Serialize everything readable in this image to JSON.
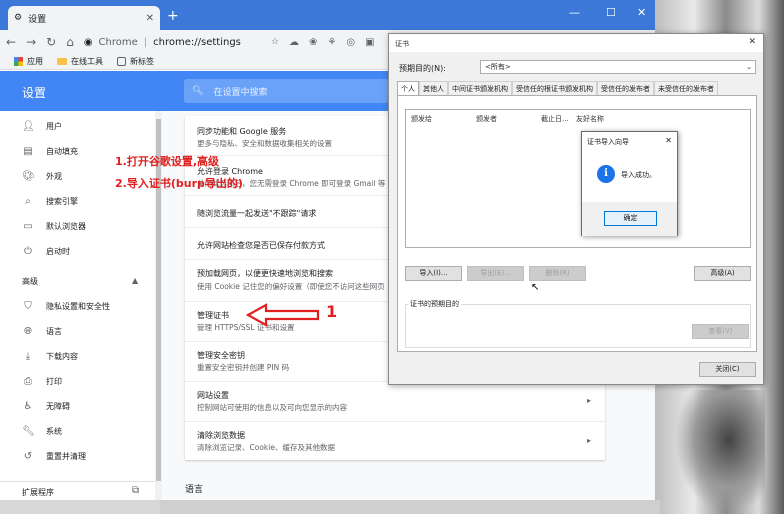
{
  "browser": {
    "tab_title": "设置",
    "url_prefix": "Chrome",
    "url": "chrome://settings",
    "bookmarks": [
      {
        "label": "应用"
      },
      {
        "label": "在线工具"
      },
      {
        "label": "新标签"
      }
    ]
  },
  "settings": {
    "title": "设置",
    "search_placeholder": "在设置中搜索",
    "sidebar": {
      "items": [
        {
          "label": "用户",
          "icon": "person-icon"
        },
        {
          "label": "自动填充",
          "icon": "clipboard-icon"
        },
        {
          "label": "外观",
          "icon": "palette-icon"
        },
        {
          "label": "搜索引擎",
          "icon": "search-icon"
        },
        {
          "label": "默认浏览器",
          "icon": "browser-icon"
        },
        {
          "label": "启动时",
          "icon": "power-icon"
        }
      ],
      "advanced_label": "高级",
      "advanced_items": [
        {
          "label": "隐私设置和安全性",
          "icon": "shield-icon"
        },
        {
          "label": "语言",
          "icon": "globe-icon"
        },
        {
          "label": "下载内容",
          "icon": "download-icon"
        },
        {
          "label": "打印",
          "icon": "printer-icon"
        },
        {
          "label": "无障碍",
          "icon": "accessibility-icon"
        },
        {
          "label": "系统",
          "icon": "wrench-icon"
        },
        {
          "label": "重置并清理",
          "icon": "reset-icon"
        }
      ],
      "extensions_label": "扩展程序"
    },
    "rows": [
      {
        "title": "同步功能和 Google 服务",
        "sub": "更多与隐私、安全和数据收集相关的设置"
      },
      {
        "title": "允许登录 Chrome",
        "sub": "关闭此选项后，您无需登录 Chrome 即可登录 Gmail 等"
      },
      {
        "title": "随浏览流量一起发送\"不跟踪\"请求",
        "sub": ""
      },
      {
        "title": "允许网站检查您是否已保存付款方式",
        "sub": ""
      },
      {
        "title": "预加载网页，以便更快速地浏览和搜索",
        "sub": "使用 Cookie 记住您的偏好设置（即使您不访问这些网页"
      },
      {
        "title": "管理证书",
        "sub": "管理 HTTPS/SSL 证书和设置"
      },
      {
        "title": "管理安全密钥",
        "sub": "重置安全密钥并创建 PIN 码"
      },
      {
        "title": "网站设置",
        "sub": "控制网站可使用的信息以及可向您显示的内容"
      },
      {
        "title": "清除浏览数据",
        "sub": "清除浏览记录、Cookie、缓存及其他数据"
      }
    ],
    "language_section": "语言"
  },
  "annotations": {
    "step_text_1": "1.打开谷歌设置,高级",
    "step_text_2": "2.导入证书(burp导出的)",
    "num_1": "1",
    "num_2": "2"
  },
  "cert_dialog": {
    "title": "证书",
    "purpose_label": "预期目的(N):",
    "purpose_value": "<所有>",
    "tabs": [
      "个人",
      "其他人",
      "中间证书颁发机构",
      "受信任的根证书颁发机构",
      "受信任的发布者",
      "未受信任的发布者"
    ],
    "columns": [
      "颁发给",
      "颁发者",
      "截止日...",
      "友好名称"
    ],
    "buttons": {
      "import": "导入(I)...",
      "export": "导出(E)...",
      "remove": "删除(R)",
      "advanced": "高级(A)",
      "view": "查看(V)",
      "close": "关闭(C)"
    },
    "group_label": "证书的预期目的"
  },
  "import_wizard": {
    "title": "证书导入向导",
    "message": "导入成功。",
    "ok": "确定"
  },
  "colors": {
    "annotation": "#e02020",
    "chrome_blue": "#4285f4"
  }
}
